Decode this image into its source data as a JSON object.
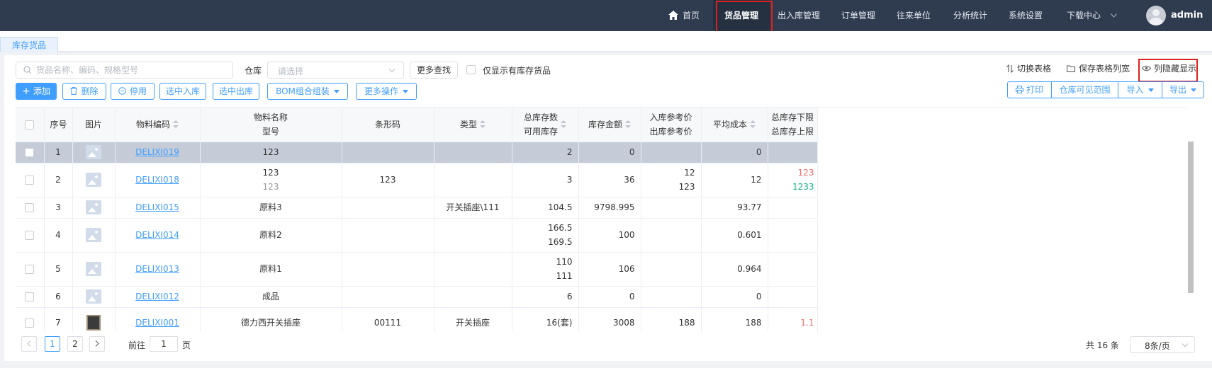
{
  "nav": {
    "home": "首页",
    "items": [
      "货品管理",
      "出入库管理",
      "订单管理",
      "往来单位",
      "分析统计",
      "系统设置",
      "下载中心"
    ],
    "user": "admin"
  },
  "tab": {
    "label": "库存货品"
  },
  "toolbar": {
    "search_placeholder": "货品名称、编码、规格型号",
    "warehouse_label": "仓库",
    "warehouse_placeholder": "请选择",
    "more_search": "更多查找",
    "only_stock": "仅显示有库存货品",
    "switch_table": "切换表格",
    "save_width": "保存表格列宽",
    "toggle_columns": "列隐藏显示",
    "add": "添加",
    "delete": "删除",
    "disable": "停用",
    "in_selected": "选中入库",
    "out_selected": "选中出库",
    "bom": "BOM组合组装",
    "more_ops": "更多操作",
    "print": "打印",
    "visible_scope": "仓库可见范围",
    "import": "导入",
    "export": "导出"
  },
  "table": {
    "headers": {
      "seq": "序号",
      "image": "图片",
      "code": "物料编码",
      "name": "物料名称",
      "model": "型号",
      "barcode": "条形码",
      "type": "类型",
      "total_stock": "总库存数",
      "avail_stock": "可用库存",
      "amount": "库存金额",
      "in_price": "入库参考价",
      "out_price": "出库参考价",
      "avg_cost": "平均成本",
      "min_stock": "总库存下限",
      "max_stock": "总库存上限"
    },
    "rows": [
      {
        "seq": "1",
        "code": "DELIXI019",
        "name": "123",
        "model": "",
        "barcode": "",
        "type": "",
        "total": "2",
        "avail": "",
        "amount": "0",
        "in_price": "",
        "out_price": "",
        "avg": "0",
        "min": "",
        "max": ""
      },
      {
        "seq": "2",
        "code": "DELIXI018",
        "name": "123",
        "model": "123",
        "barcode": "123",
        "type": "",
        "total": "3",
        "avail": "",
        "amount": "36",
        "in_price": "12",
        "out_price": "123",
        "avg": "12",
        "min": "123",
        "max": "1233"
      },
      {
        "seq": "3",
        "code": "DELIXI015",
        "name": "原料3",
        "model": "",
        "barcode": "",
        "type": "开关插座\\111",
        "total": "104.5",
        "avail": "",
        "amount": "9798.995",
        "in_price": "",
        "out_price": "",
        "avg": "93.77",
        "min": "",
        "max": ""
      },
      {
        "seq": "4",
        "code": "DELIXI014",
        "name": "原料2",
        "model": "",
        "barcode": "",
        "type": "",
        "total": "166.5",
        "avail": "169.5",
        "amount": "100",
        "in_price": "",
        "out_price": "",
        "avg": "0.601",
        "min": "",
        "max": ""
      },
      {
        "seq": "5",
        "code": "DELIXI013",
        "name": "原料1",
        "model": "",
        "barcode": "",
        "type": "",
        "total": "110",
        "avail": "111",
        "amount": "106",
        "in_price": "",
        "out_price": "",
        "avg": "0.964",
        "min": "",
        "max": ""
      },
      {
        "seq": "6",
        "code": "DELIXI012",
        "name": "成品",
        "model": "",
        "barcode": "",
        "type": "",
        "total": "6",
        "avail": "",
        "amount": "0",
        "in_price": "",
        "out_price": "",
        "avg": "0",
        "min": "",
        "max": ""
      },
      {
        "seq": "7",
        "code": "DELIXI001",
        "name": "德力西开关插座",
        "model": "",
        "barcode": "00111",
        "type": "开关插座",
        "total": "16(套)",
        "avail": "",
        "amount": "3008",
        "in_price": "188",
        "out_price": "",
        "avg": "188",
        "min": "1.1",
        "max": ""
      }
    ]
  },
  "pagination": {
    "pages": [
      "1",
      "2"
    ],
    "goto_label": "前往",
    "goto_value": "1",
    "page_unit": "页",
    "total": "共 16 条",
    "page_size": "8条/页"
  },
  "colors": {
    "nav_bg": "#2f3b4f",
    "accent": "#409eff",
    "highlight": "#e02020",
    "selected_row": "#c5ccd8"
  }
}
